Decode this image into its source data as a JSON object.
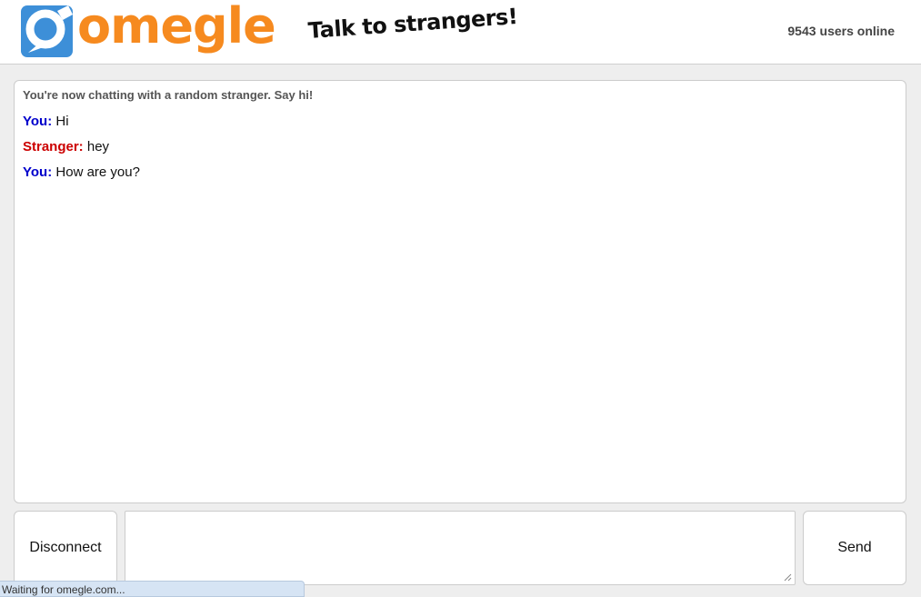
{
  "header": {
    "logo_text": "omegle",
    "logo_icon": "omegle-speech-bubble-icon",
    "tagline": "Talk to strangers!",
    "online_count": "9543",
    "online_label": "users online"
  },
  "colors": {
    "logo_orange": "#f68a1f",
    "logo_blue": "#3d8fd8",
    "you": "#0000cc",
    "stranger": "#cc0000"
  },
  "chat": {
    "status": "You're now chatting with a random stranger. Say hi!",
    "messages": [
      {
        "speaker": "You:",
        "text": "Hi"
      },
      {
        "speaker": "Stranger:",
        "text": "hey"
      },
      {
        "speaker": "You:",
        "text": "How are you?"
      }
    ]
  },
  "controls": {
    "disconnect_label": "Disconnect",
    "input_value": "",
    "send_label": "Send"
  },
  "statusbar": {
    "text": "Waiting for omegle.com..."
  }
}
